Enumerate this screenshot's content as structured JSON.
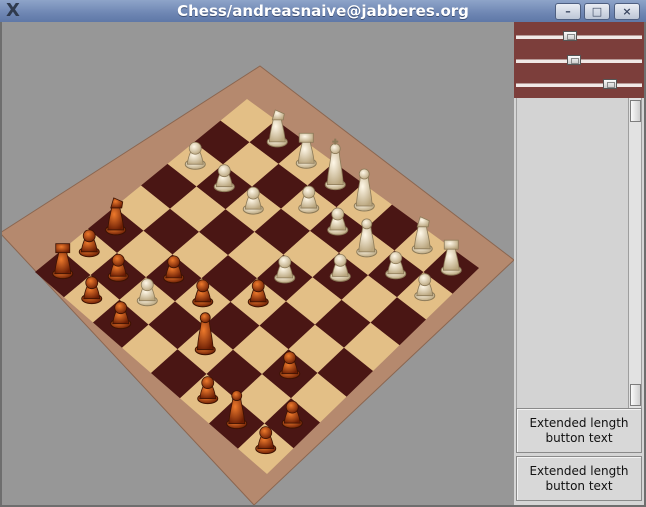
{
  "window": {
    "title": "Chess/andreasnaive@jabberes.org",
    "controls": {
      "minimize": "–",
      "maximize": "□",
      "close": "×"
    },
    "app_icon": "X"
  },
  "board": {
    "light_square_color": "#e3bf86",
    "dark_square_color": "#4a1614",
    "frame_color": "#b5896e",
    "background_color": "#979797",
    "white_piece_color": "#efe0bf",
    "black_piece_color": "#b5400d"
  },
  "sliders": {
    "level_1": 0.4,
    "level_2": 0.44,
    "level_3": 0.76
  },
  "buttons": {
    "button_1": "Extended length button text",
    "button_2": "Extended length button text"
  },
  "scrollbar": {
    "handle_top_label": "",
    "handle_bottom_label": ""
  }
}
